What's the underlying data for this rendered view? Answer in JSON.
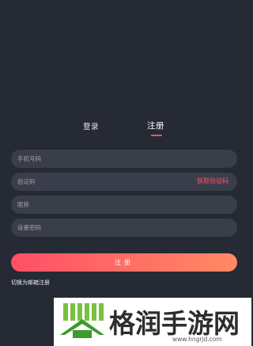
{
  "tabs": {
    "login_label": "登录",
    "register_label": "注册",
    "active": "register"
  },
  "form": {
    "phone_placeholder": "手机号码",
    "code_placeholder": "验证码",
    "get_code_label": "获取验证码",
    "nickname_placeholder": "昵称",
    "password_placeholder": "设置密码"
  },
  "actions": {
    "register_label": "注册",
    "switch_label": "切换为邮箱注册"
  },
  "watermark": {
    "title": "格润手游网",
    "url": "www.hngrjd.com"
  },
  "colors": {
    "background": "#262a35",
    "field": "#3a3e4b",
    "accent": "#ff5468",
    "gradient_start": "#ff4f66",
    "gradient_end": "#ff8a63"
  }
}
